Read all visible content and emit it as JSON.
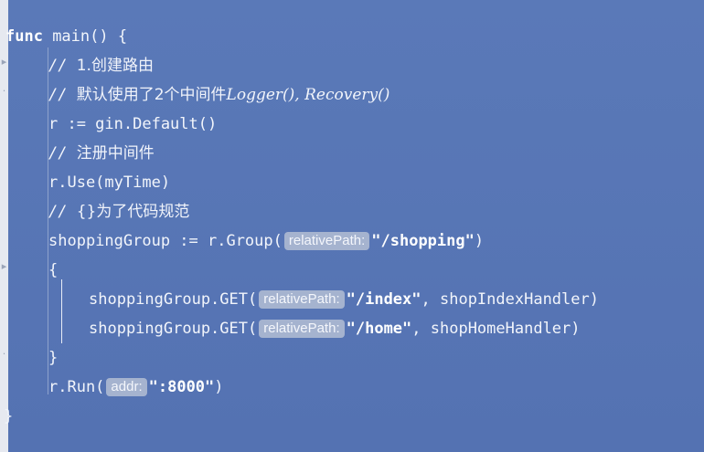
{
  "code": {
    "line1": {
      "keyword": "func",
      "rest": " main() {"
    },
    "line2": {
      "slashes": "// ",
      "text": "1.创建路由"
    },
    "line3": {
      "slashes": "// ",
      "text": "默认使用了2个中间件",
      "italic": "Logger(), Recovery()"
    },
    "line4": {
      "text": "r := gin.Default()"
    },
    "line5": {
      "slashes": "// ",
      "text": "注册中间件"
    },
    "line6": {
      "text": "r.Use(myTime)"
    },
    "line7": {
      "slashes": "// ",
      "text": "{}为了代码规范"
    },
    "line8": {
      "before": "shoppingGroup := r.Group(",
      "hint": "relativePath:",
      "str": "\"/shopping\"",
      "after": ")"
    },
    "line9": {
      "text": "{"
    },
    "line10": {
      "before": "shoppingGroup.GET(",
      "hint": "relativePath:",
      "str": "\"/index\"",
      "after": ", shopIndexHandler)"
    },
    "line11": {
      "before": "shoppingGroup.GET(",
      "hint": "relativePath:",
      "str": "\"/home\"",
      "after": ", shopHomeHandler)"
    },
    "line12": {
      "text": "}"
    },
    "line13": {
      "before": "r.Run(",
      "hint": "addr:",
      "str": "\":8000\"",
      "after": ")"
    },
    "line14": {
      "text": "}"
    }
  },
  "colors": {
    "background": "#5676b6",
    "hint_background": "#a5b3cf",
    "text": "#f2f5fb"
  }
}
